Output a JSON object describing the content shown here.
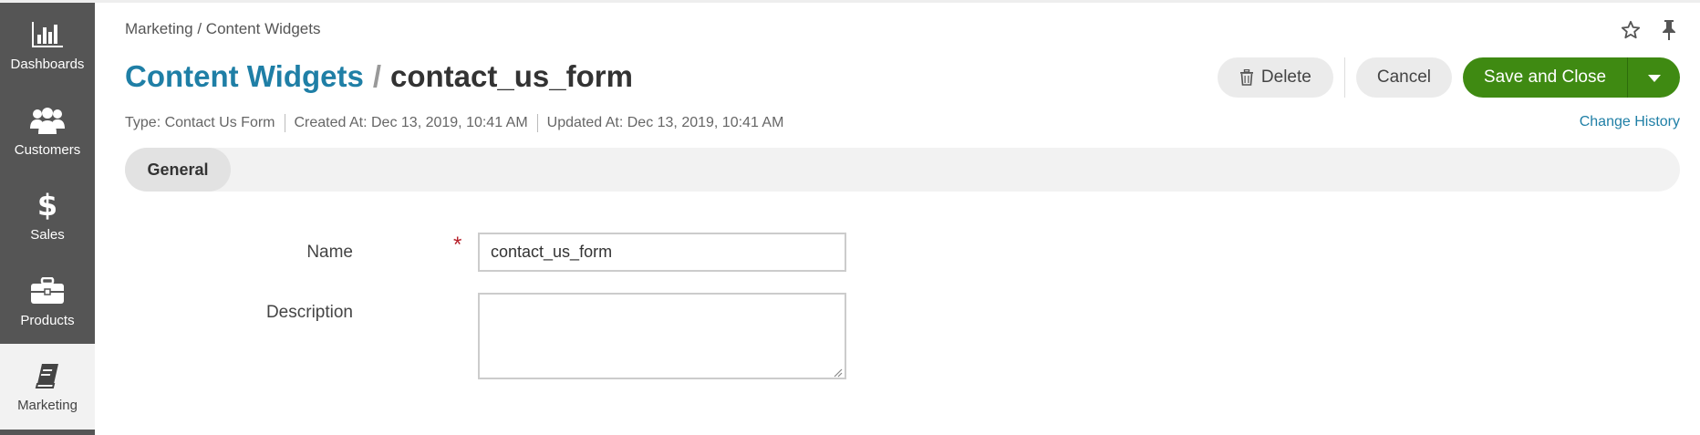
{
  "sidebar": {
    "items": [
      {
        "label": "Dashboards",
        "icon": "bar-chart-icon"
      },
      {
        "label": "Customers",
        "icon": "users-icon"
      },
      {
        "label": "Sales",
        "icon": "dollar-icon"
      },
      {
        "label": "Products",
        "icon": "briefcase-icon"
      },
      {
        "label": "Marketing",
        "icon": "book-icon",
        "active": true
      }
    ]
  },
  "header": {
    "breadcrumb": "Marketing / Content Widgets",
    "title_link": "Content Widgets",
    "title_separator": "/",
    "title_entity": "contact_us_form"
  },
  "actions": {
    "delete_label": "Delete",
    "cancel_label": "Cancel",
    "save_label": "Save and Close"
  },
  "meta": {
    "type": "Type: Contact Us Form",
    "created": "Created At: Dec 13, 2019, 10:41 AM",
    "updated": "Updated At: Dec 13, 2019, 10:41 AM",
    "change_history": "Change History"
  },
  "tabs": [
    {
      "label": "General",
      "active": true
    }
  ],
  "form": {
    "name_label": "Name",
    "name_required_mark": "*",
    "name_value": "contact_us_form",
    "description_label": "Description",
    "description_value": ""
  },
  "colors": {
    "sidebar_bg": "#555555",
    "link": "#1f7fa6",
    "primary": "#3f8a12",
    "required": "#b6202a"
  }
}
